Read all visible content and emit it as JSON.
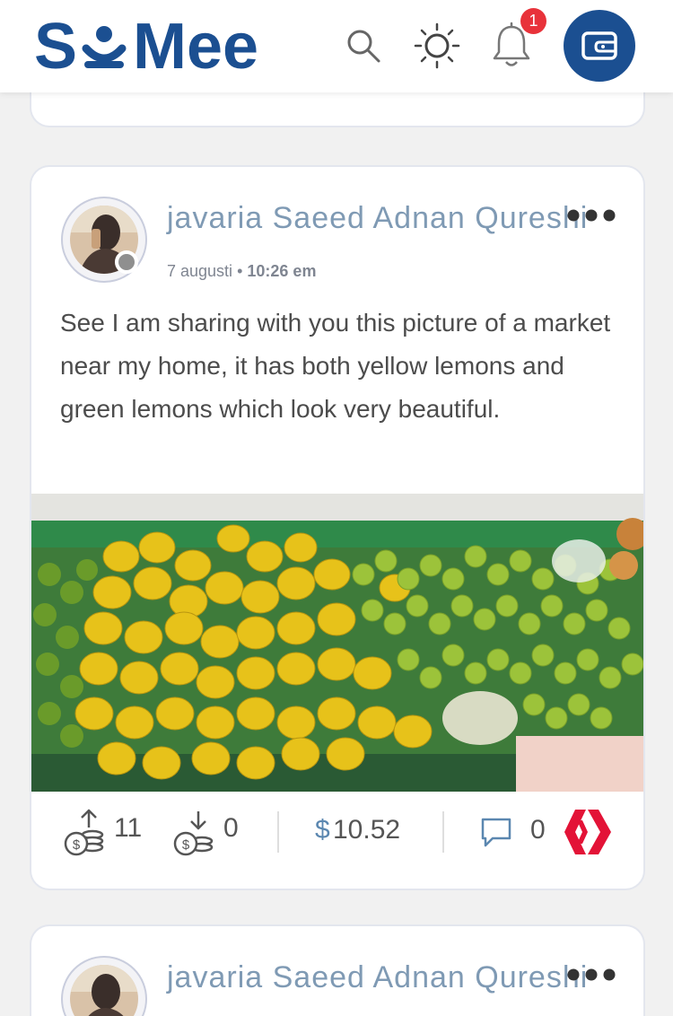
{
  "header": {
    "logo_text": "SêMee",
    "notification_count": "1",
    "icons": [
      "search-icon",
      "theme-sun-icon",
      "bell-icon",
      "wallet-icon"
    ]
  },
  "post": {
    "author": "javaria Saeed Adnan Qureshi",
    "date": "7 augusti",
    "time": "10:26 em",
    "body": "See I am sharing with you this picture of a market near my home, it has both yellow lemons and green lemons which look very beautiful.",
    "image_alt": "market stall with yellow and green lemons",
    "upvotes": "11",
    "downvotes": "0",
    "payout_symbol": "$",
    "payout": "10.52",
    "comments": "0"
  },
  "next_post": {
    "author": "javaria Saeed Adnan Qureshi"
  },
  "colors": {
    "brand": "#1b4f91",
    "badge": "#e8323a",
    "hive": "#e31337",
    "author": "#7f9ab4",
    "payout": "#5b87b0"
  }
}
